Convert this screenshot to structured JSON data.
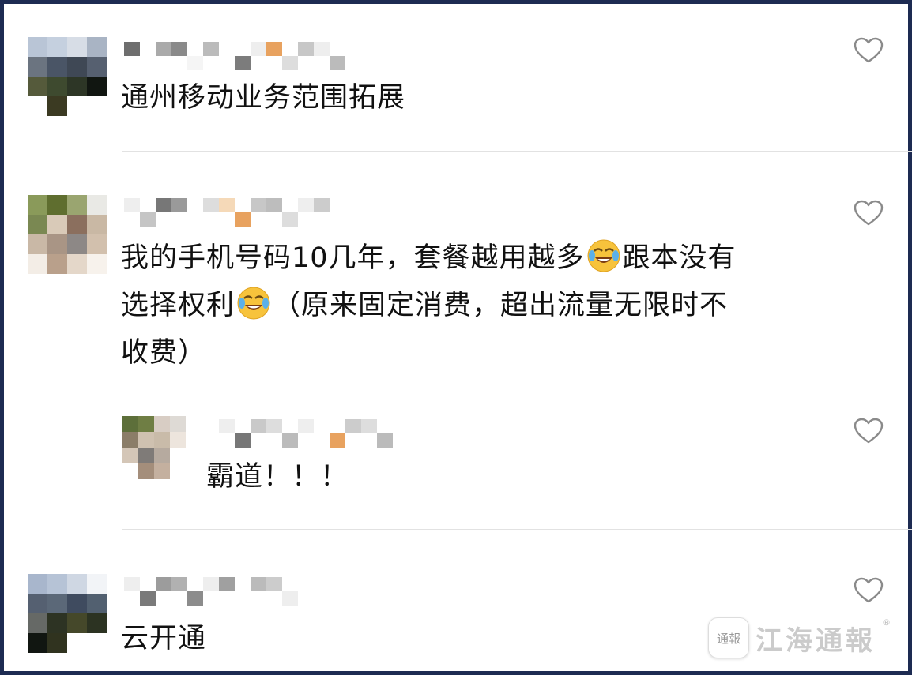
{
  "comments": [
    {
      "id": "c1",
      "text_lines": [
        "通州移动业务范围拓展"
      ],
      "like_icon": "heart-outline-icon",
      "avatar_colors": [
        "#b9c5d6",
        "#c5d0df",
        "#d7dde6",
        "#a9b4c4",
        "#6b7480",
        "#4a5566",
        "#3f4855",
        "#566070",
        "#555a3b",
        "#3e4a2f",
        "#2d3626",
        "#111611",
        "#ffffff",
        "#3b3a22",
        "#ffffff",
        "#ffffff"
      ],
      "name_colors": [
        "#6e6e6e",
        "#ffffff",
        "#aaaaaa",
        "#8a8a8a",
        "#f5f5f5",
        "#bbbbbb",
        "#ffffff",
        "#7c7c7c",
        "#eeeeee",
        "#e8a25f",
        "#dddddd",
        "#c7c7c7",
        "#eeeeee",
        "#bbbbbb"
      ]
    },
    {
      "id": "c2",
      "text_lines": [
        "我的手机号码10几年，套餐越用越多",
        "跟本没有",
        "选择权利",
        "（原来固定消费，超出流量无限时不",
        "收费）"
      ],
      "emoji": "face-with-tears-of-joy-icon",
      "like_icon": "heart-outline-icon",
      "avatar_colors": [
        "#8a9a5a",
        "#5f6e2f",
        "#9aa570",
        "#e9e9e5",
        "#7a8852",
        "#d9cab8",
        "#8b6f5e",
        "#c9b8a4",
        "#c9b8a6",
        "#a99585",
        "#8d8886",
        "#d2c0ad",
        "#f3ede6",
        "#b9a08b",
        "#e4d7c9",
        "#f7f2ec"
      ],
      "name_colors": [
        "#eeeeee",
        "#c5c5c5",
        "#777777",
        "#9a9a9a",
        "#ffffff",
        "#dddddd",
        "#f5d9b8",
        "#e8a25f",
        "#c7c7c7",
        "#bdbdbd",
        "#dddddd",
        "#eeeeee",
        "#cccccc"
      ]
    },
    {
      "id": "c3",
      "text_lines": [
        "霸道！！！"
      ],
      "like_icon": "heart-outline-icon",
      "avatar_colors": [
        "#5d6f3a",
        "#6f7e44",
        "#d8cdc4",
        "#dedad5",
        "#8b7d68",
        "#cfc1b0",
        "#c9bba9",
        "#ede5dd",
        "#d4c6b7",
        "#7f7b78",
        "#b6aa9f",
        "#ffffff",
        "#ffffff",
        "#a48e7b",
        "#c4b09f",
        "#ffffff"
      ],
      "name_colors": [
        "#eeeeee",
        "#777777",
        "#c9c9c9",
        "#dddddd",
        "#bbbbbb",
        "#eeeeee",
        "#ffffff",
        "#e8a25f",
        "#cccccc",
        "#dddddd",
        "#bbbbbb"
      ]
    },
    {
      "id": "c4",
      "text_lines": [
        "云开通"
      ],
      "like_icon": "heart-outline-icon",
      "avatar_colors": [
        "#a8b6cc",
        "#b6c3d6",
        "#cfd7e3",
        "#f2f4f7",
        "#556071",
        "#5b6878",
        "#3f4b5f",
        "#526070",
        "#666966",
        "#2d3323",
        "#45482a",
        "#2c3322",
        "#111611",
        "#30331f",
        "#ffffff",
        "#ffffff"
      ],
      "name_colors": [
        "#eeeeee",
        "#7a7a7a",
        "#9c9c9c",
        "#b1b1b1",
        "#8c8c8c",
        "#eeeeee",
        "#a0a0a0",
        "#ffffff",
        "#bbbbbb",
        "#cccccc",
        "#eeeeee"
      ]
    }
  ],
  "watermark": {
    "seal_text": "通報",
    "brand_text": "江海通報",
    "reg_mark": "®"
  },
  "colors": {
    "frame": "#1d2b52",
    "text": "#111111",
    "heart": "#8a8a8a",
    "divider": "#e2e2e2"
  }
}
